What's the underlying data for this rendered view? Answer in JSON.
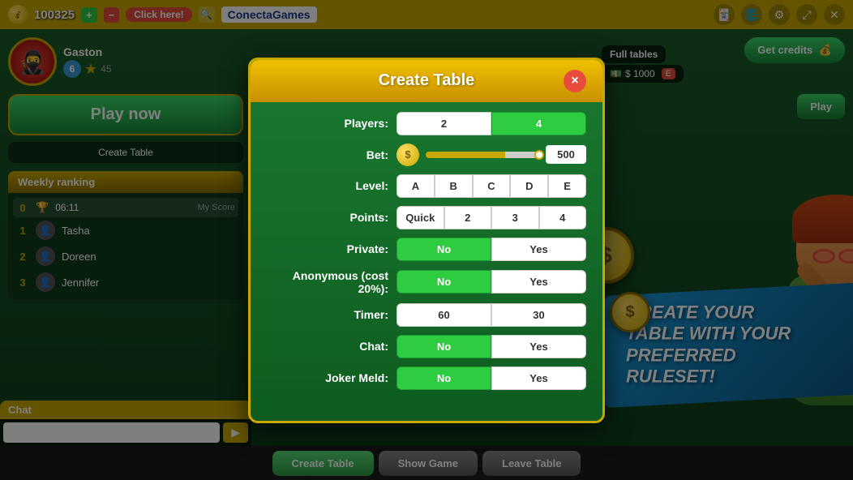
{
  "topbar": {
    "coin_icon": "💰",
    "score": "100325",
    "add_label": "+",
    "minus_label": "−",
    "click_here": "Click here!",
    "logo": "ConectaGames",
    "icons": [
      "🃏",
      "🌐",
      "⚙",
      "✕✕",
      "✕"
    ]
  },
  "avatar": {
    "name": "Gaston",
    "level": "6",
    "score": "45"
  },
  "buttons": {
    "play_now": "Play now",
    "create_table": "Create Table",
    "get_credits": "Get credits",
    "play": "Play"
  },
  "full_tables": {
    "label": "Full tables",
    "price": "$ 1000"
  },
  "weekly_ranking": {
    "title": "Weekly ranking",
    "timer": "06:11",
    "my_score_label": "My Score",
    "items": [
      {
        "rank": "1",
        "name": "Tasha"
      },
      {
        "rank": "2",
        "name": "Doreen"
      },
      {
        "rank": "3",
        "name": "Jennifer"
      }
    ]
  },
  "chat": {
    "title": "Chat",
    "input_placeholder": ""
  },
  "bottom_buttons": [
    {
      "label": "Create Table",
      "active": true
    },
    {
      "label": "Show Game",
      "active": false
    },
    {
      "label": "Leave Table",
      "active": false
    }
  ],
  "modal": {
    "title": "Create Table",
    "close_label": "×",
    "rows": [
      {
        "label": "Players:",
        "options": [
          {
            "value": "2",
            "selected": false
          },
          {
            "value": "4",
            "selected": true
          }
        ]
      },
      {
        "label": "Bet:",
        "type": "slider",
        "value": "500"
      },
      {
        "label": "Level:",
        "options": [
          {
            "value": "A",
            "selected": false
          },
          {
            "value": "B",
            "selected": false
          },
          {
            "value": "C",
            "selected": false
          },
          {
            "value": "D",
            "selected": false
          },
          {
            "value": "E",
            "selected": false
          }
        ]
      },
      {
        "label": "Points:",
        "options": [
          {
            "value": "Quick",
            "selected": false
          },
          {
            "value": "2",
            "selected": false
          },
          {
            "value": "3",
            "selected": false
          },
          {
            "value": "4",
            "selected": false
          }
        ]
      },
      {
        "label": "Private:",
        "options": [
          {
            "value": "No",
            "selected": true
          },
          {
            "value": "Yes",
            "selected": false
          }
        ]
      },
      {
        "label": "Anonymous (cost 20%):",
        "options": [
          {
            "value": "No",
            "selected": true
          },
          {
            "value": "Yes",
            "selected": false
          }
        ]
      },
      {
        "label": "Timer:",
        "options": [
          {
            "value": "60",
            "selected": false
          },
          {
            "value": "30",
            "selected": false
          }
        ]
      },
      {
        "label": "Chat:",
        "options": [
          {
            "value": "No",
            "selected": true
          },
          {
            "value": "Yes",
            "selected": false
          }
        ]
      },
      {
        "label": "Joker Meld:",
        "options": [
          {
            "value": "No",
            "selected": true
          },
          {
            "value": "Yes",
            "selected": false
          }
        ]
      }
    ]
  },
  "promo": {
    "line1": "CREATE YOUR",
    "line2": "TABLE WITH YOUR",
    "line3": "PREFERRED",
    "line4": "RULESET!"
  }
}
